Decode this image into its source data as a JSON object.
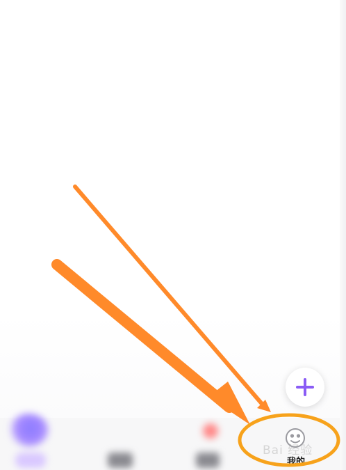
{
  "tabbar": {
    "active_label": "我的"
  },
  "fab": {
    "icon": "plus-icon",
    "color": "#8a5cf5"
  },
  "watermark": {
    "text": "Bai 经验"
  },
  "annotation": {
    "color": "#ff8a2a",
    "ellipse_color": "#f7a21b"
  }
}
